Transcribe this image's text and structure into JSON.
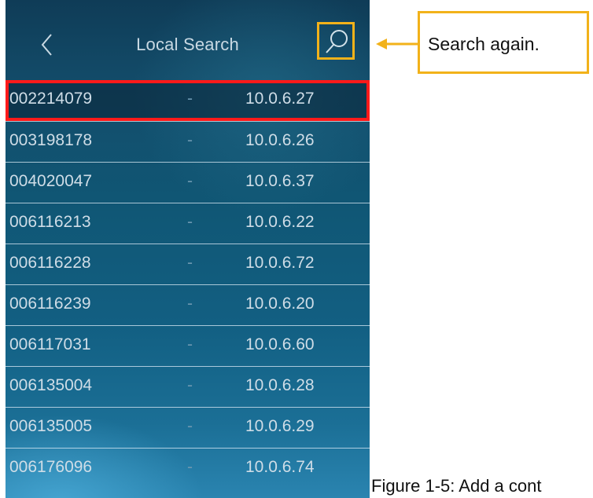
{
  "header": {
    "title": "Local Search",
    "back_icon": "chevron-left-icon",
    "search_icon": "search-icon"
  },
  "devices": [
    {
      "id": "002214079",
      "separator": "-",
      "ip": "10.0.6.27",
      "selected": true
    },
    {
      "id": "003198178",
      "separator": "-",
      "ip": "10.0.6.26"
    },
    {
      "id": "004020047",
      "separator": "-",
      "ip": "10.0.6.37"
    },
    {
      "id": "006116213",
      "separator": "-",
      "ip": "10.0.6.22"
    },
    {
      "id": "006116228",
      "separator": "-",
      "ip": "10.0.6.72"
    },
    {
      "id": "006116239",
      "separator": "-",
      "ip": "10.0.6.20"
    },
    {
      "id": "006117031",
      "separator": "-",
      "ip": "10.0.6.60"
    },
    {
      "id": "006135004",
      "separator": "-",
      "ip": "10.0.6.28"
    },
    {
      "id": "006135005",
      "separator": "-",
      "ip": "10.0.6.29"
    },
    {
      "id": "006176096",
      "separator": "-",
      "ip": "10.0.6.74"
    }
  ],
  "annotation": {
    "callout_text": "Search again.",
    "caption": "Figure 1-5: Add a cont",
    "highlight_color": "#f2b21a",
    "selection_color": "#ff1a1a"
  }
}
